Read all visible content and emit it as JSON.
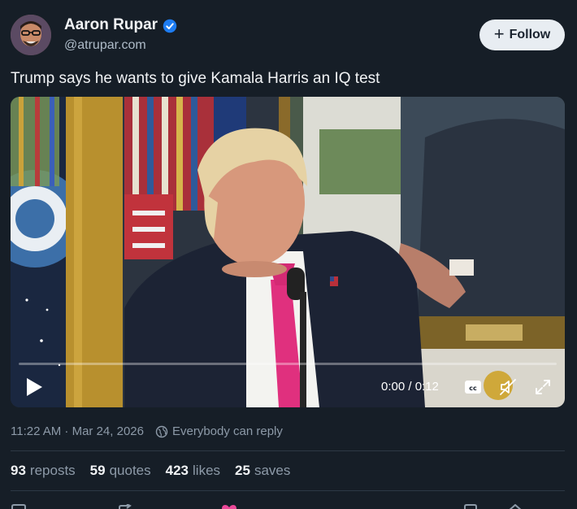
{
  "author": {
    "name": "Aaron Rupar",
    "handle": "@atrupar.com",
    "verified_color": "#1d7cf2"
  },
  "follow_button": {
    "icon": "plus-icon",
    "label": "Follow"
  },
  "post": {
    "text": "Trump says he wants to give Kamala Harris an IQ test"
  },
  "video": {
    "time_display": "0:00 / 0:12",
    "progress": 0.0,
    "controls": [
      "play-icon",
      "closed-captions-icon",
      "mute-icon",
      "fullscreen-icon"
    ]
  },
  "meta": {
    "timestamp": "11:22 AM · Mar 24, 2026",
    "reply_setting": "Everybody can reply",
    "reply_icon": "globe-icon"
  },
  "stats": [
    {
      "count": "93",
      "label": "reposts"
    },
    {
      "count": "59",
      "label": "quotes"
    },
    {
      "count": "423",
      "label": "likes"
    },
    {
      "count": "25",
      "label": "saves"
    }
  ],
  "actions": [
    "reply-icon",
    "repost-icon",
    "like-icon",
    "bookmark-icon",
    "share-icon"
  ],
  "colors": {
    "background": "#161e27",
    "text_primary": "#f1f3f5",
    "text_secondary": "#8d9aa8",
    "like_accent": "#ec4899"
  }
}
